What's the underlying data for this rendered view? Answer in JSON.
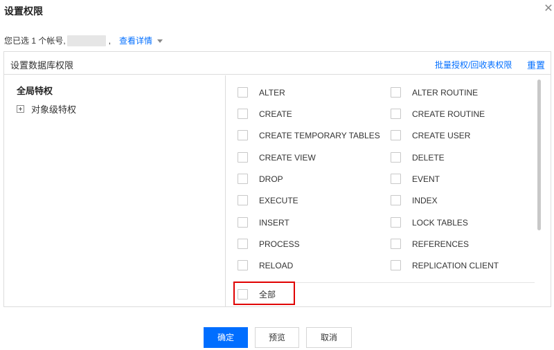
{
  "dialog": {
    "title": "设置权限",
    "close_glyph": "✕"
  },
  "account": {
    "prefix": "您已选 1 个帐号,",
    "separator": ",",
    "details_link": "查看详情"
  },
  "panel": {
    "title": "设置数据库权限",
    "batch_link": "批量授权/回收表权限",
    "reset_link": "重置"
  },
  "tree": {
    "global": "全局特权",
    "object_level": "对象级特权"
  },
  "privileges_col1": [
    "ALTER",
    "CREATE",
    "CREATE TEMPORARY TABLES",
    "CREATE VIEW",
    "DROP",
    "EXECUTE",
    "INSERT",
    "PROCESS",
    "RELOAD"
  ],
  "privileges_col2": [
    "ALTER ROUTINE",
    "CREATE ROUTINE",
    "CREATE USER",
    "DELETE",
    "EVENT",
    "INDEX",
    "LOCK TABLES",
    "REFERENCES",
    "REPLICATION CLIENT"
  ],
  "select_all": "全部",
  "buttons": {
    "confirm": "确定",
    "preview": "预览",
    "cancel": "取消"
  },
  "colors": {
    "accent": "#006eff",
    "highlight": "#e00000"
  },
  "icons": {
    "close": "close-icon",
    "caret": "caret-down-icon",
    "expand": "plus-icon"
  }
}
